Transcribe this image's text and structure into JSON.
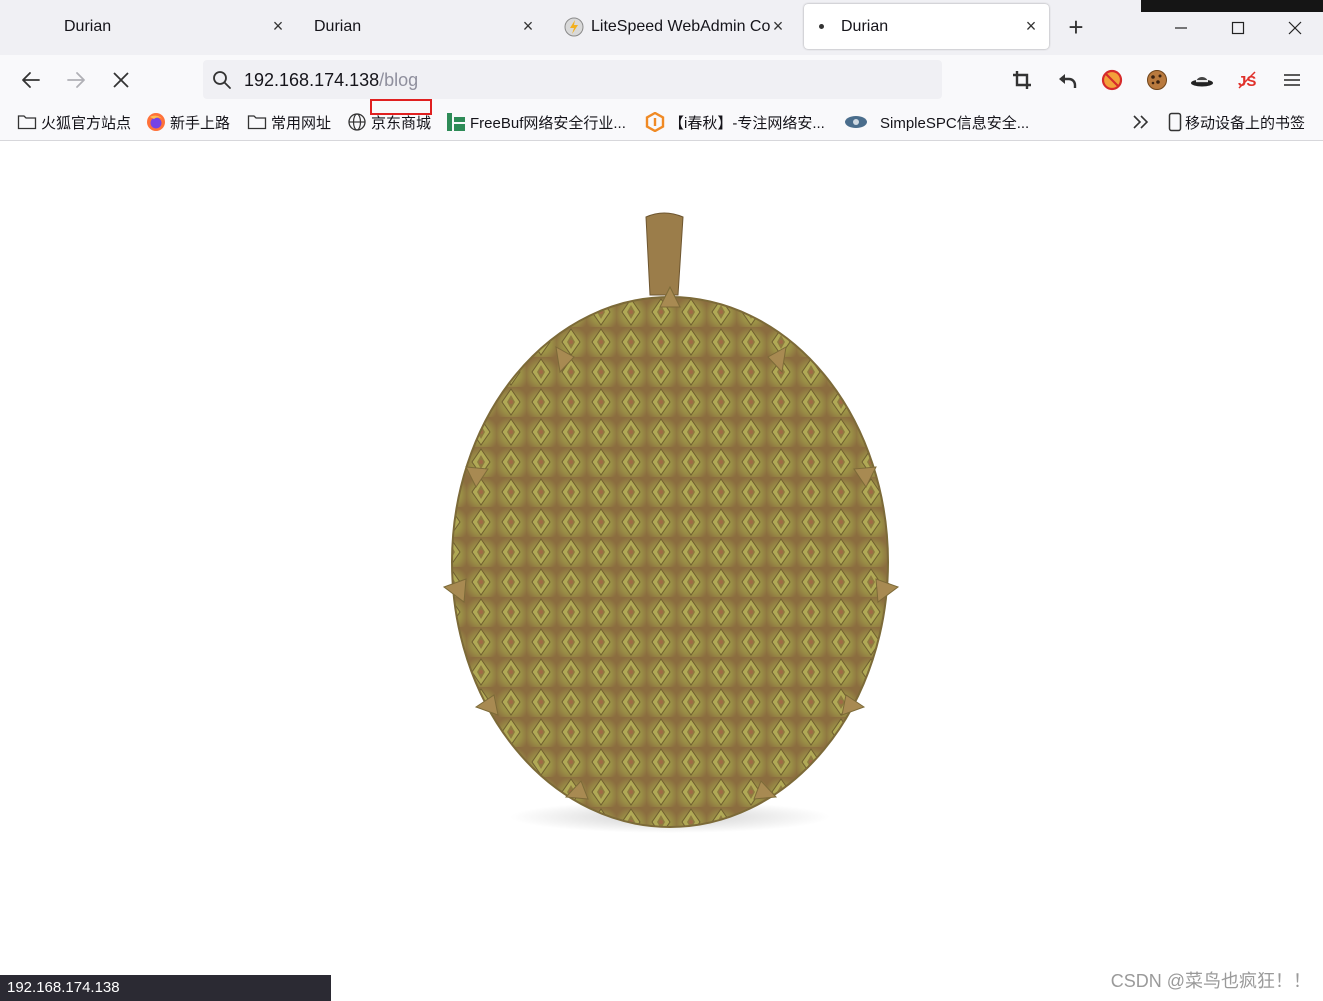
{
  "tabs": [
    {
      "title": "Durian",
      "close": "×"
    },
    {
      "title": "Durian",
      "close": "×"
    },
    {
      "title": "LiteSpeed WebAdmin Co",
      "close": "×"
    },
    {
      "title": "Durian",
      "close": "×"
    }
  ],
  "new_tab": "+",
  "url": {
    "host": "192.168.174.138",
    "path": "/blog"
  },
  "bookmarks": [
    {
      "label": "火狐官方站点",
      "icon": "folder-icon"
    },
    {
      "label": "新手上路",
      "icon": "firefox-icon"
    },
    {
      "label": "常用网址",
      "icon": "folder-icon"
    },
    {
      "label": "京东商城",
      "icon": "globe-icon"
    },
    {
      "label": "FreeBuf网络安全行业...",
      "icon": "freebuf-icon"
    },
    {
      "label": "【i春秋】-专注网络安...",
      "icon": "ichunqiu-icon"
    },
    {
      "label": "SimpleSPC信息安全...",
      "icon": "simplespc-icon"
    }
  ],
  "mobile_bookmarks": "移动设备上的书签",
  "status_url": "192.168.174.138",
  "watermark": "CSDN @菜鸟也疯狂！！",
  "colors": {
    "accent": "#e02020",
    "tabbar": "#f0f0f4",
    "status_bg": "#2b2a33"
  }
}
